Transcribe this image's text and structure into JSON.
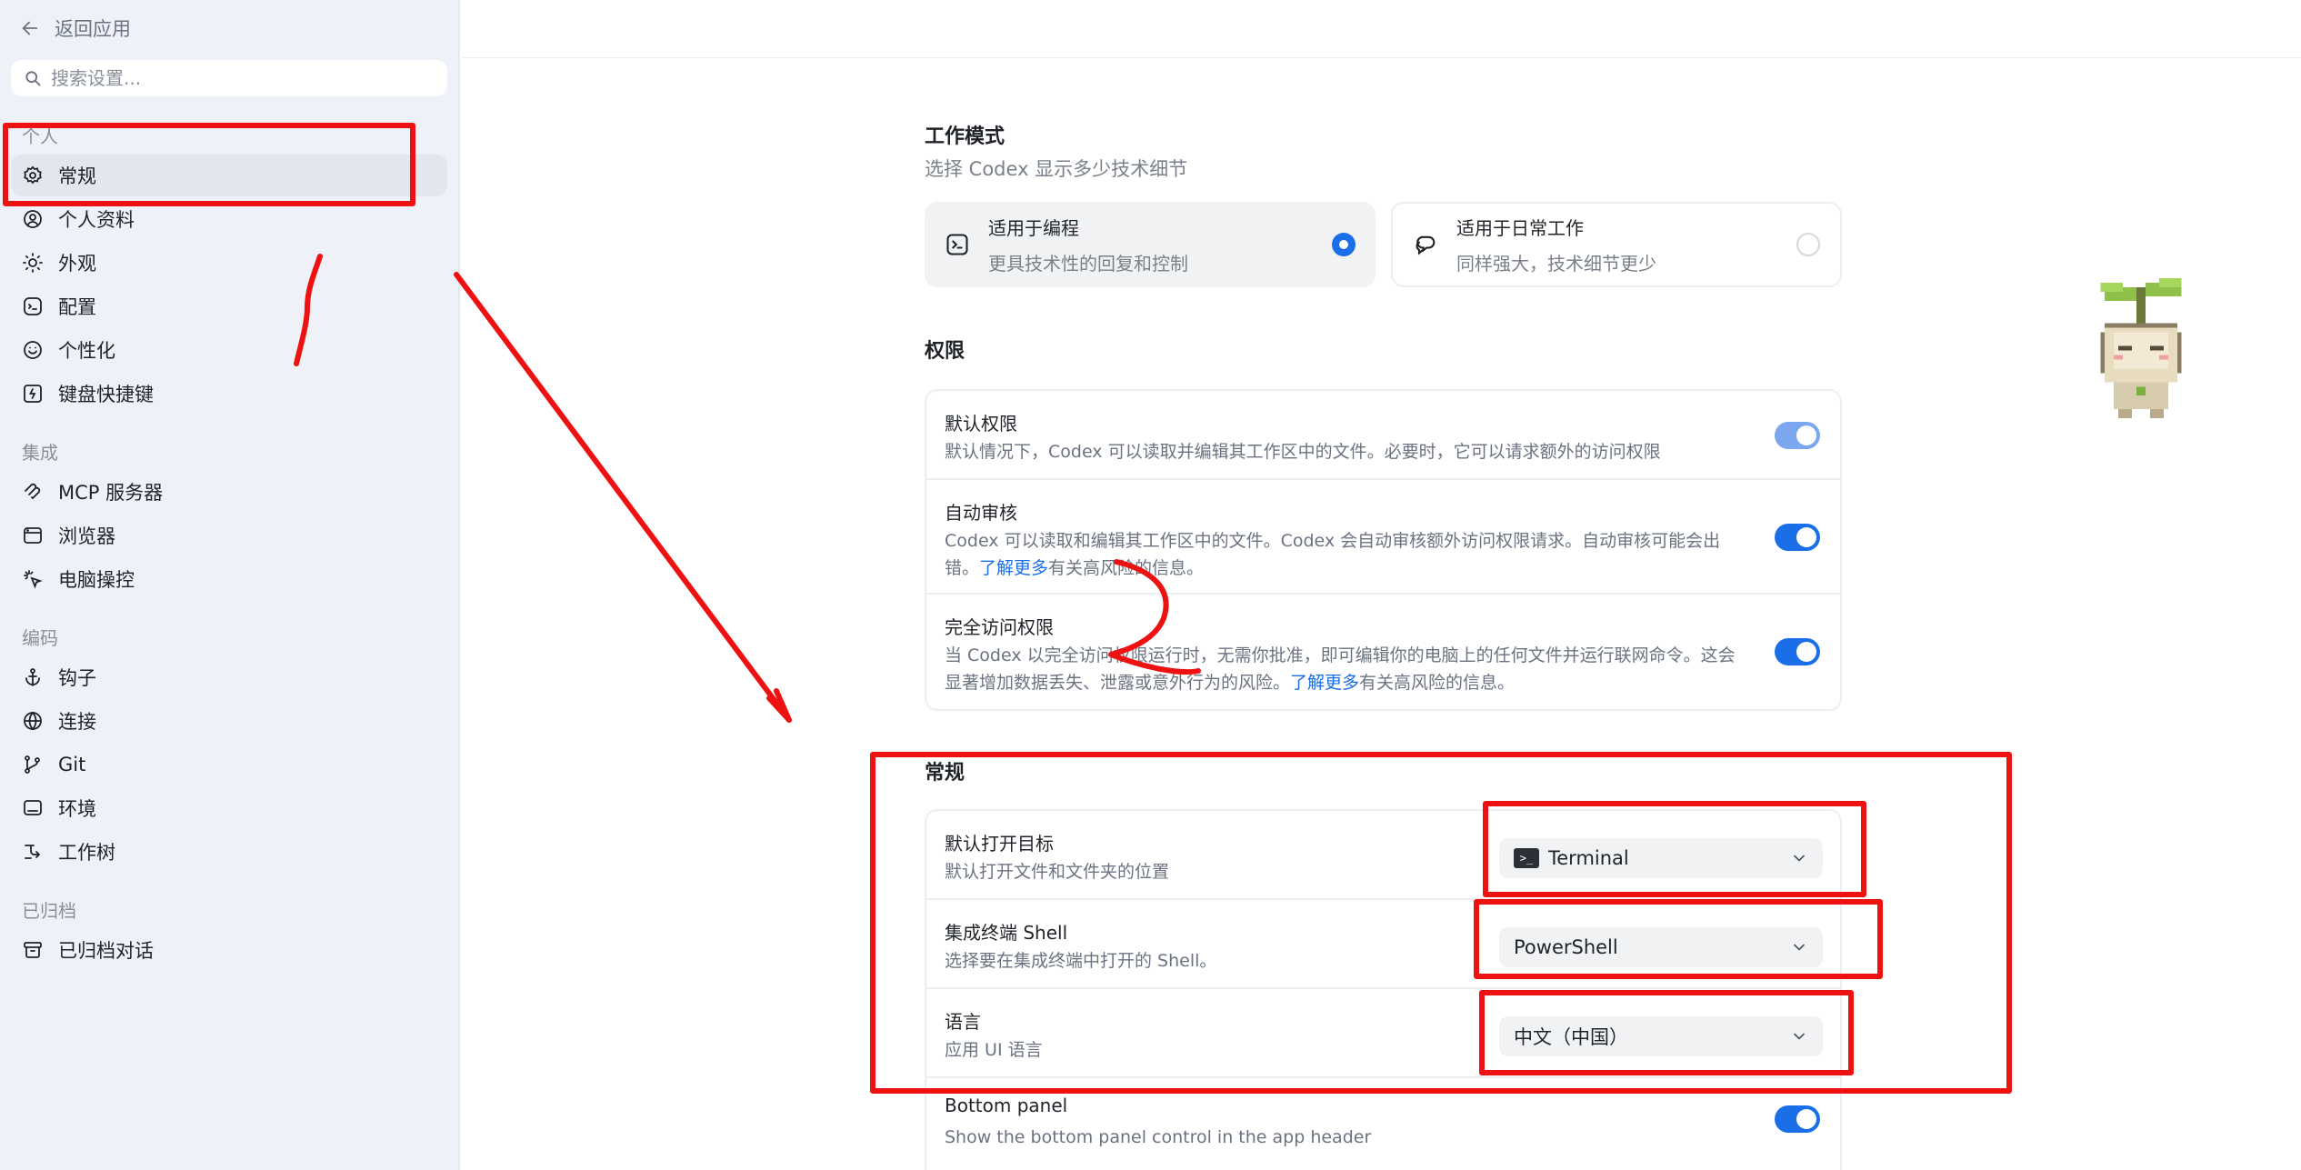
{
  "sidebar": {
    "back_label": "返回应用",
    "search_placeholder": "搜索设置...",
    "groups": {
      "personal": "个人",
      "integrations": "集成",
      "coding": "编码",
      "archived": "已归档"
    },
    "items": {
      "general": "常规",
      "profile": "个人资料",
      "appearance": "外观",
      "config": "配置",
      "personalize": "个性化",
      "shortcuts": "键盘快捷键",
      "mcp": "MCP 服务器",
      "browser": "浏览器",
      "computer_control": "电脑操控",
      "hooks": "钩子",
      "connections": "连接",
      "git": "Git",
      "environment": "环境",
      "worktree": "工作树",
      "archived_chats": "已归档对话"
    }
  },
  "work_mode": {
    "title": "工作模式",
    "subtitle": "选择 Codex 显示多少技术细节",
    "coding": {
      "label": "适用于编程",
      "desc": "更具技术性的回复和控制",
      "selected": true
    },
    "daily": {
      "label": "适用于日常工作",
      "desc": "同样强大，技术细节更少",
      "selected": false
    }
  },
  "permissions": {
    "title": "权限",
    "default": {
      "title": "默认权限",
      "desc": "默认情况下，Codex 可以读取并编辑其工作区中的文件。必要时，它可以请求额外的访问权限",
      "enabled": true
    },
    "auto_review": {
      "title": "自动审核",
      "desc_line1": "Codex 可以读取和编辑其工作区中的文件。Codex 会自动审核额外访问权限请求。自动审核可能会出",
      "desc_pre": "错。",
      "link": "了解更多",
      "desc_post": "有关高风险的信息。",
      "enabled": true
    },
    "full_access": {
      "title": "完全访问权限",
      "desc_line1": "当 Codex 以完全访问权限运行时，无需你批准，即可编辑你的电脑上的任何文件并运行联网命令。这会",
      "desc_pre": "显著增加数据丢失、泄露或意外行为的风险。",
      "link": "了解更多",
      "desc_post": "有关高风险的信息。",
      "enabled": true
    }
  },
  "general": {
    "title": "常规",
    "open_target": {
      "title": "默认打开目标",
      "desc": "默认打开文件和文件夹的位置",
      "value": "Terminal"
    },
    "shell": {
      "title": "集成终端 Shell",
      "desc": "选择要在集成终端中打开的 Shell。",
      "value": "PowerShell"
    },
    "language": {
      "title": "语言",
      "desc": "应用 UI 语言",
      "value": "中文（中国）"
    },
    "bottom_panel": {
      "title": "Bottom panel",
      "desc": "Show the bottom panel control in the app header",
      "enabled": true
    }
  },
  "colors": {
    "accent": "#1a6ee8",
    "annotation": "#ee1111",
    "sidebar_bg": "#eef2f8"
  }
}
